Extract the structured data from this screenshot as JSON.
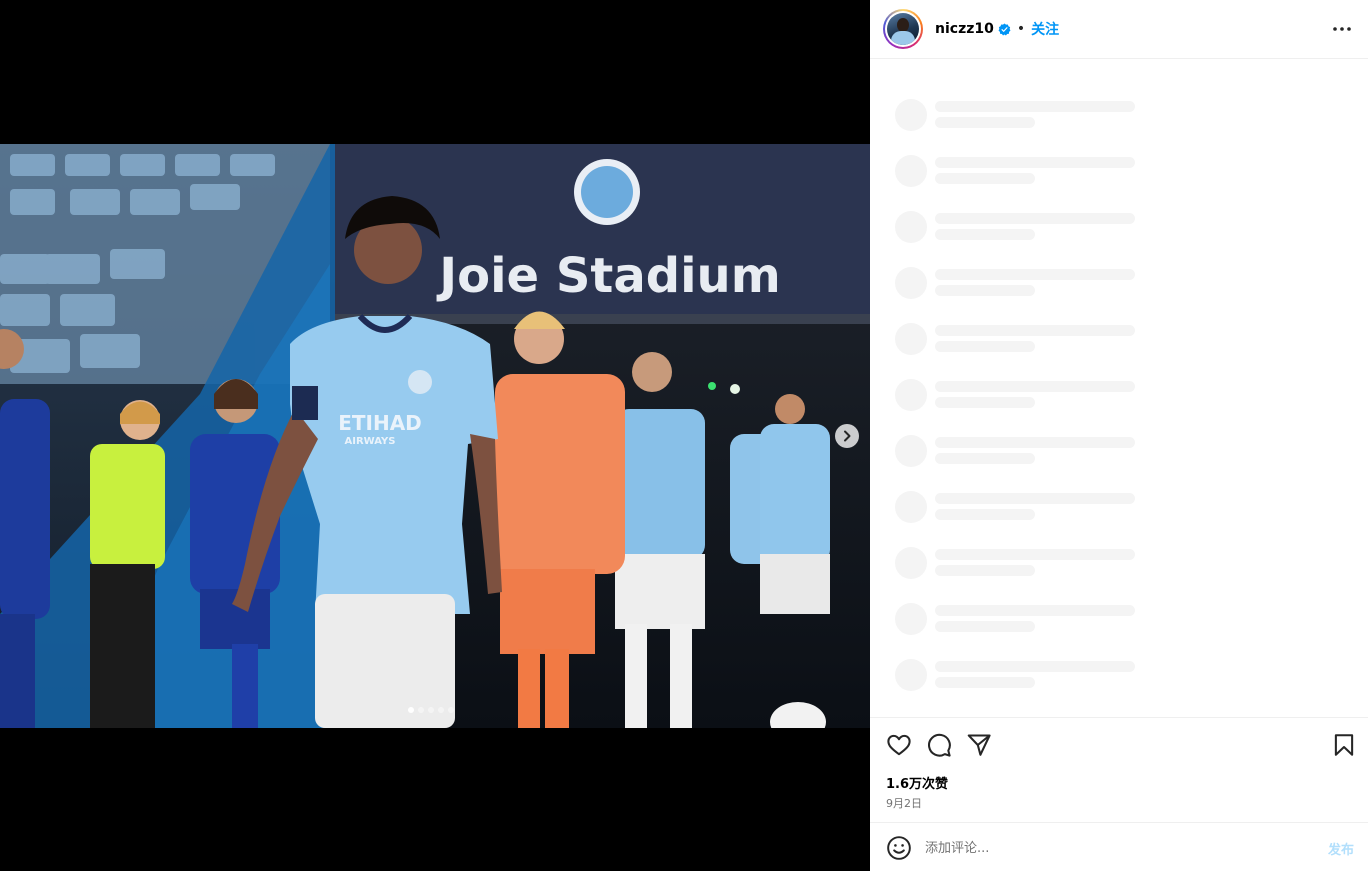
{
  "media": {
    "stadium_sign": "Joie Stadium",
    "shirt_sponsor_main": "ETIHAD",
    "shirt_sponsor_sub": "AIRWAYS",
    "carousel_count": 5,
    "carousel_active_index": 0,
    "next_icon": "chevron-right-icon"
  },
  "post": {
    "username": "niczz10",
    "verified": true,
    "separator": "•",
    "follow_label": "关注",
    "more_icon": "more-horizontal-icon"
  },
  "comments": {
    "loading_placeholders": 11
  },
  "actions": {
    "like_icon": "heart-icon",
    "comment_icon": "comment-icon",
    "share_icon": "send-icon",
    "save_icon": "bookmark-icon"
  },
  "stats": {
    "likes": "1.6万次赞",
    "date": "9月2日"
  },
  "composer": {
    "emoji_icon": "emoji-icon",
    "placeholder": "添加评论...",
    "post_label": "发布"
  },
  "colors": {
    "accent": "#0095f6",
    "post_disabled": "#b2dffc",
    "verified": "#0095f6"
  }
}
